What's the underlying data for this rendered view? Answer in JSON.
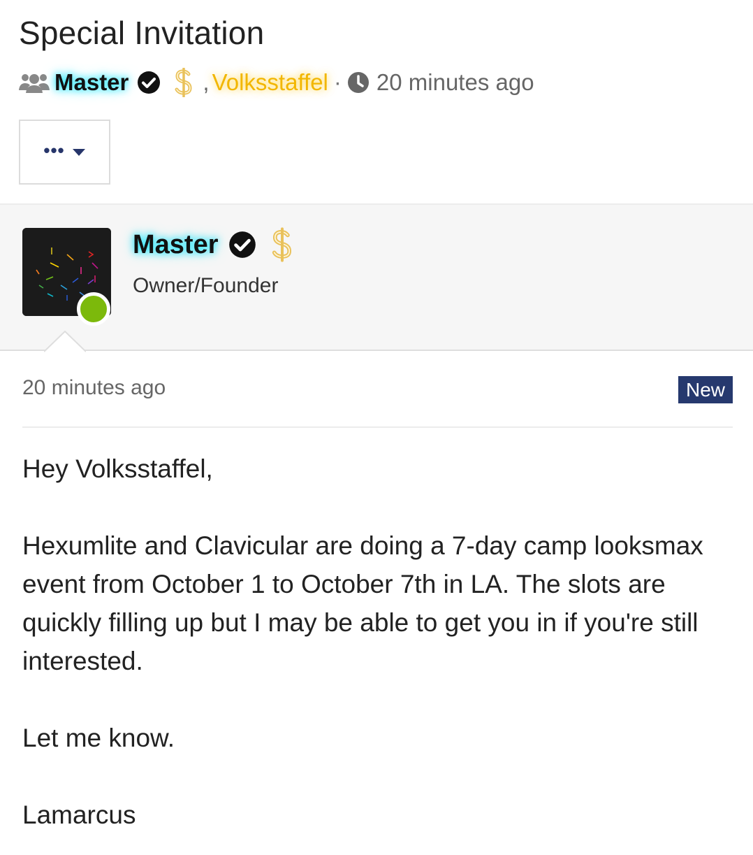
{
  "title": "Special Invitation",
  "meta": {
    "group_icon": "people-icon",
    "author": "Master",
    "verified_icon": "verified-check-icon",
    "donor_icon": "dollar-icon",
    "comma": ",",
    "recipient": "Volksstaffel",
    "separator": "·",
    "clock_icon": "clock-icon",
    "time": "20 minutes ago"
  },
  "actions": {
    "more_dots": "•••",
    "caret_icon": "caret-down-icon"
  },
  "author_card": {
    "name": "Master",
    "role": "Owner/Founder",
    "status": "online",
    "status_color": "#7cb90b"
  },
  "post": {
    "time": "20 minutes ago",
    "badge": "New",
    "greeting": "Hey Volksstaffel,",
    "paragraph": "Hexumlite and Clavicular are doing a 7-day camp looksmax event from October 1 to October 7th in LA. The slots are quickly filling up but I may be able to get you in if you're still interested.",
    "closing": "Let me know.",
    "signature": "Lamarcus"
  },
  "colors": {
    "accent_navy": "#26396e",
    "glow_cyan": "#00e6ff",
    "gold": "#f2b600",
    "online_green": "#7cb90b"
  }
}
